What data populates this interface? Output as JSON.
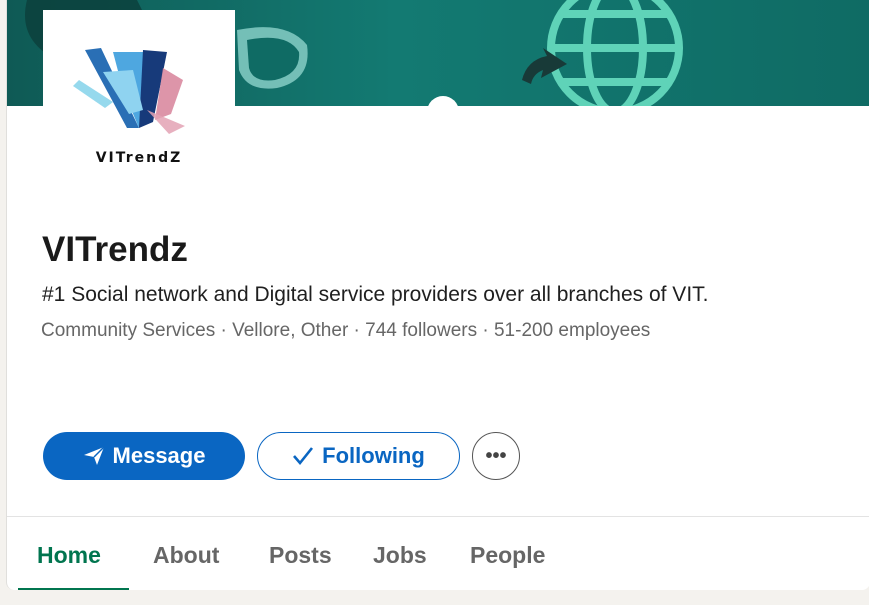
{
  "company": {
    "logo_text": "VITrendZ",
    "name": "VITrendz",
    "tagline": "#1 Social network and Digital service providers over all branches of VIT.",
    "meta_line": "Community Services · Vellore, Other · 744 followers · 51-200 employees"
  },
  "actions": {
    "message_label": "Message",
    "following_label": "Following",
    "more_label": "•••"
  },
  "tabs": [
    {
      "label": "Home",
      "active": true
    },
    {
      "label": "About",
      "active": false
    },
    {
      "label": "Posts",
      "active": false
    },
    {
      "label": "Jobs",
      "active": false
    },
    {
      "label": "People",
      "active": false
    }
  ],
  "colors": {
    "primary": "#0a66c2",
    "active_tab": "#01754f",
    "banner": "#137a72"
  }
}
